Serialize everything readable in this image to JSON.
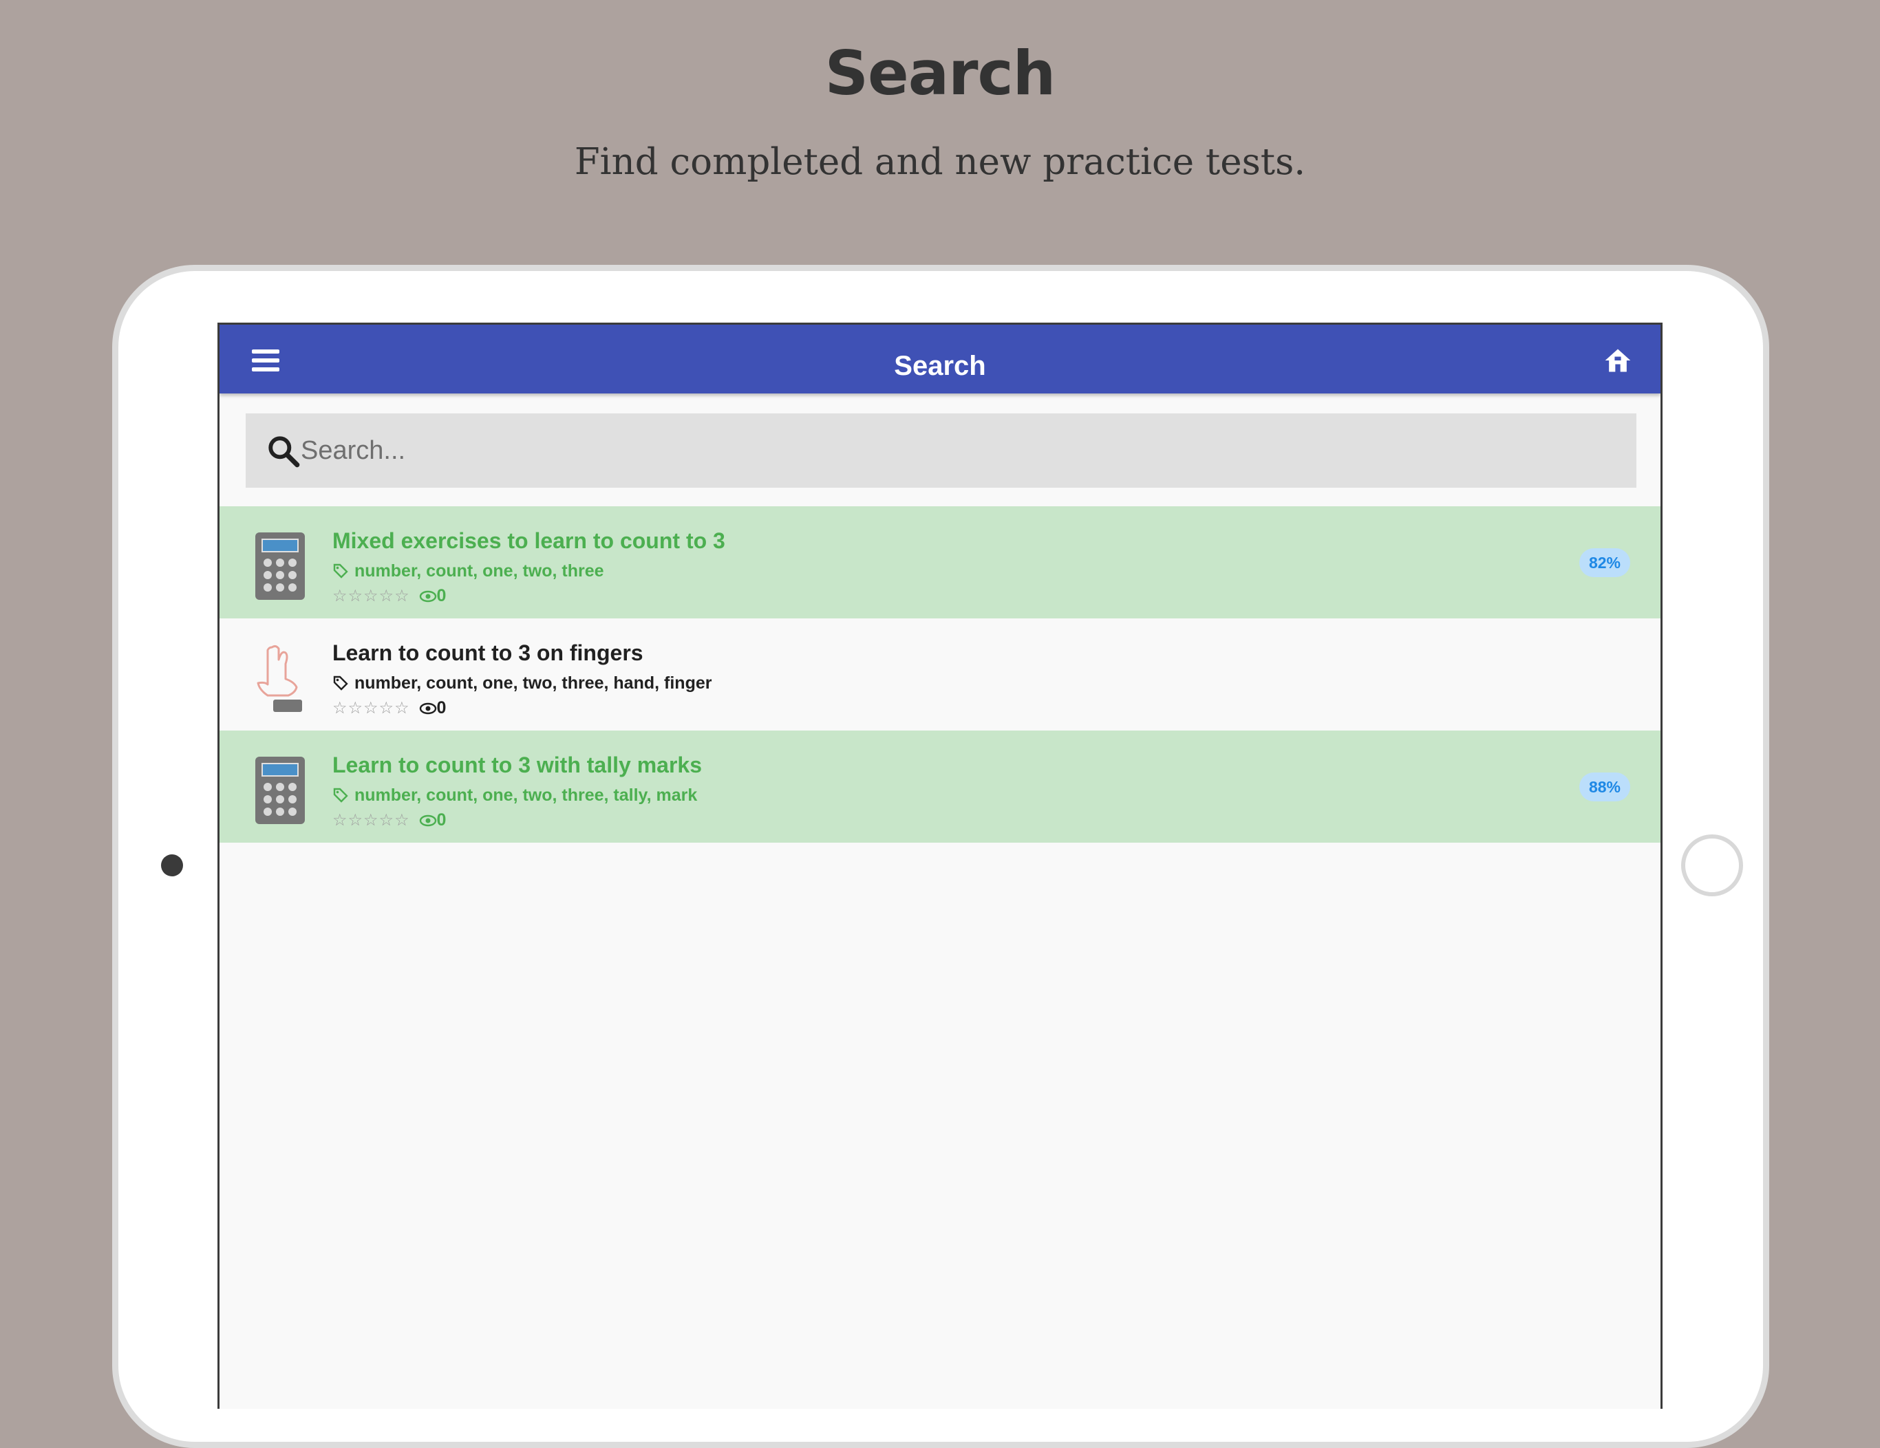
{
  "promo": {
    "title": "Search",
    "subtitle": "Find completed and new practice tests."
  },
  "app_bar": {
    "title": "Search",
    "menu_icon": "hamburger-menu-icon",
    "home_icon": "home-icon"
  },
  "search": {
    "placeholder": "Search...",
    "value": ""
  },
  "results": [
    {
      "title": "Mixed exercises to learn to count to 3",
      "tags": "number, count, one, two, three",
      "stars": "☆☆☆☆☆",
      "views": "0",
      "score": "82%",
      "status": "completed",
      "icon": "calculator-icon"
    },
    {
      "title": "Learn to count to 3 on fingers",
      "tags": "number, count, one, two, three, hand, finger",
      "stars": "☆☆☆☆☆",
      "views": "0",
      "score": "",
      "status": "new",
      "icon": "hand-fingers-icon"
    },
    {
      "title": "Learn to count to 3 with tally marks",
      "tags": "number, count, one, two, three, tally, mark",
      "stars": "☆☆☆☆☆",
      "views": "0",
      "score": "88%",
      "status": "completed",
      "icon": "calculator-icon"
    }
  ],
  "colors": {
    "app_bar": "#3f51b5",
    "completed_row": "#c8e6c9",
    "completed_text": "#4caf50",
    "badge_bg": "#bbdefb",
    "badge_text": "#1e88e5",
    "background": "#ada29e"
  }
}
